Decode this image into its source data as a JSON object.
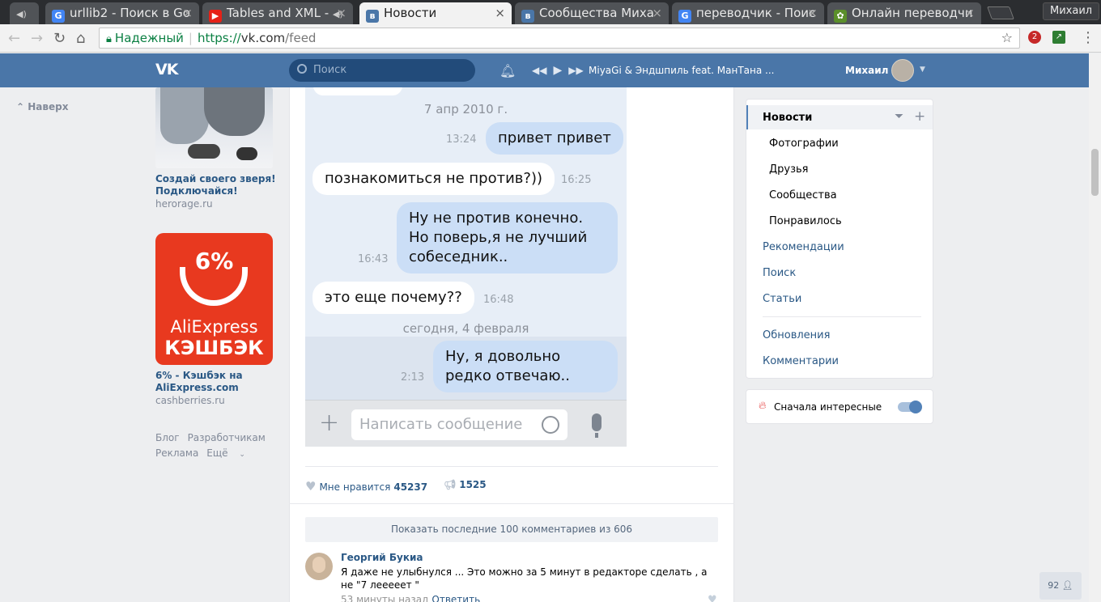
{
  "browser": {
    "tabs": [
      {
        "title": "urllib2 - Поиск в Go",
        "icon": "google-icon"
      },
      {
        "title": "Tables and XML -",
        "icon": "youtube-icon"
      },
      {
        "title": "Новости",
        "icon": "vk-icon"
      },
      {
        "title": "Сообщества Миха",
        "icon": "vk-icon"
      },
      {
        "title": "переводчик - Поис",
        "icon": "google-icon"
      },
      {
        "title": "Онлайн переводчи",
        "icon": "translator-icon"
      }
    ],
    "profile": "Михаил",
    "secure_label": "Надежный",
    "url_scheme": "https://",
    "url_host": "vk.com",
    "url_path": "/feed",
    "ext_badge": "2"
  },
  "header": {
    "logo": "VK",
    "search_placeholder": "Поиск",
    "track": "MiyaGi & Эндшпиль feat. МанТана ...",
    "user": "Михаил"
  },
  "left": {
    "back_to_top": "Наверх",
    "ads": [
      {
        "title": "Создай своего зверя! Подключайся!",
        "domain": "herorage.ru"
      },
      {
        "title": "6% - Кэшбэк на AliExpress.com",
        "domain": "cashberries.ru",
        "badge_pct": "6%",
        "badge_brand": "AliExpress",
        "badge_cash": "КЭШБЭК"
      }
    ],
    "footer": [
      "Блог",
      "Разработчикам",
      "Реклама",
      "Ещё"
    ]
  },
  "chat": {
    "date1": "7 апр 2010 г.",
    "messages": [
      {
        "text": "привет привет",
        "time": "13:24",
        "dir": "out"
      },
      {
        "text": "познакомиться не против?))",
        "time": "16:25",
        "dir": "in"
      },
      {
        "text": "Ну не против конечно. Но поверь,я не лучший собеседник..",
        "time": "16:43",
        "dir": "out"
      },
      {
        "text": "это еще почему??",
        "time": "16:48",
        "dir": "in"
      },
      {
        "text": "Ну, я довольно редко отвечаю..",
        "time": "2:13",
        "dir": "out"
      }
    ],
    "date2": "сегодня, 4 февраля",
    "composer_placeholder": "Написать сообщение"
  },
  "post": {
    "like_label": "Мне нравится",
    "like_count": "45237",
    "share_count": "1525",
    "show_comments": "Показать последние 100 комментариев из 606",
    "comment": {
      "author": "Георгий Букиа",
      "text": "Я даже не улыбнулся ... Это можно за 5 минут в редакторе сделать , а не \"7 лееееет \"",
      "time": "53 минуты назад",
      "reply": "Ответить"
    }
  },
  "right": {
    "menu": [
      "Новости",
      "Фотографии",
      "Друзья",
      "Сообщества",
      "Понравилось",
      "Рекомендации",
      "Поиск",
      "Статьи",
      "Обновления",
      "Комментарии"
    ],
    "toggle_label": "Сначала интересные",
    "toggle_on": true
  },
  "online_count": "92",
  "colors": {
    "vk_blue": "#4a76a8",
    "link": "#2a5885",
    "bubble_out": "#cbdef6"
  }
}
